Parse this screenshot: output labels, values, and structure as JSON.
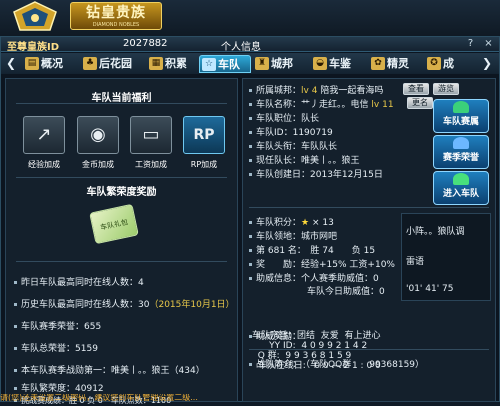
{
  "banner": {
    "title": "钻皇贵族",
    "subtitle": "DIAMOND NOBLES"
  },
  "titlebar": {
    "nobility": "至尊皇族ID",
    "user_id": "2027882",
    "window_title": "个人信息",
    "help": "?",
    "close": "×"
  },
  "tabs": [
    {
      "label": "概况",
      "icon": "card-icon"
    },
    {
      "label": "后花园",
      "icon": "garden-icon"
    },
    {
      "label": "积累",
      "icon": "stack-icon"
    },
    {
      "label": "车队",
      "icon": "star-icon",
      "active": true
    },
    {
      "label": "城邦",
      "icon": "castle-icon"
    },
    {
      "label": "车鉴",
      "icon": "car-icon"
    },
    {
      "label": "精灵",
      "icon": "spirit-icon"
    },
    {
      "label": "成",
      "icon": "medal-icon"
    }
  ],
  "left": {
    "welfare_title": "车队当前福利",
    "welfare": [
      {
        "label": "经验加成",
        "icon": "growth-icon"
      },
      {
        "label": "金币加成",
        "icon": "coin-icon"
      },
      {
        "label": "工资加成",
        "icon": "salary-card-icon"
      },
      {
        "label": "RP加成",
        "icon": "rp-icon",
        "glyph": "RP"
      }
    ],
    "honor_title": "车队繁荣度奖励",
    "honor_item": "车队礼包",
    "stats": [
      {
        "label": "昨日车队最高同时在线人数：",
        "value": "4"
      },
      {
        "label": "历史车队最高同时在线人数：",
        "value": "30",
        "extra": "（2015年10月1日）"
      },
      {
        "label": "车队赛季荣誉：",
        "value": "655"
      },
      {
        "label": "车队总荣誉：",
        "value": "5159"
      },
      {
        "label": "本车队赛季战勋第一：",
        "value": "唯美丨。。狼王（434）"
      },
      {
        "label": "车队繁荣度：",
        "value": "40912"
      },
      {
        "label": "挑战赛成绩：",
        "value": "胜 0 负 0",
        "extra_label": "车队点数：",
        "extra_value": "1100"
      }
    ]
  },
  "right": {
    "area_label": "所属城邦：",
    "area_level": "lv 4",
    "area_name": "陪我一起看海吗",
    "btn_view": "查看",
    "btn_tour": "游览",
    "name_label": "车队名称：",
    "name_value": "艹丿走红。。电信",
    "name_level": "lv 11",
    "btn_rename": "更名",
    "position_label": "车队职位：",
    "position_value": "队长",
    "id_label": "车队ID：",
    "id_value": "1190719",
    "head_label": "车队头衔：",
    "head_value": "车队队长",
    "leader_label": "现任队长：",
    "leader_value": "唯美丨。。狼王",
    "created_label": "车队创建日：",
    "created_value": "2013年12月15日",
    "big_buttons": [
      "车队赛属",
      "赛季荣誉",
      "进入车队"
    ],
    "score_label": "车队积分：",
    "score_value": "× 13",
    "territory_label": "车队领地：",
    "territory_value": "城市网吧",
    "rank_label": "第 681 名：",
    "rank_win": "胜 74",
    "rank_loss": "负 15",
    "reward_label": "奖　　励：",
    "reward_value": "经验+15% 工资+10%",
    "assist_label": "助威信息：",
    "assist_personal": "个人赛季助威值：",
    "assist_personal_value": "0",
    "assist_team": "车队今日助威值：",
    "assist_team_value": "0",
    "side_list": [
      "小阵。。狼队调",
      "雷语",
      "'01' 41' 75"
    ],
    "assist_reward_label": "助威奖励：",
    "intro_label": "战队简介：",
    "intro_value": "（车队QQ群",
    "intro_number": "99368159",
    "intro_close": "）",
    "notice": "车队宗旨：团结  友爱  有上进心\n      YY ID:  4 0 9 9 2 1 4 2\n  Q 群:  9 9 3 6 8 1 5 9\n  车队在线日:   0 0 — 2 1 : 0 0"
  },
  "marquee": "请(您)还未设置二级密码，建议您到车队管理设置二级..."
}
